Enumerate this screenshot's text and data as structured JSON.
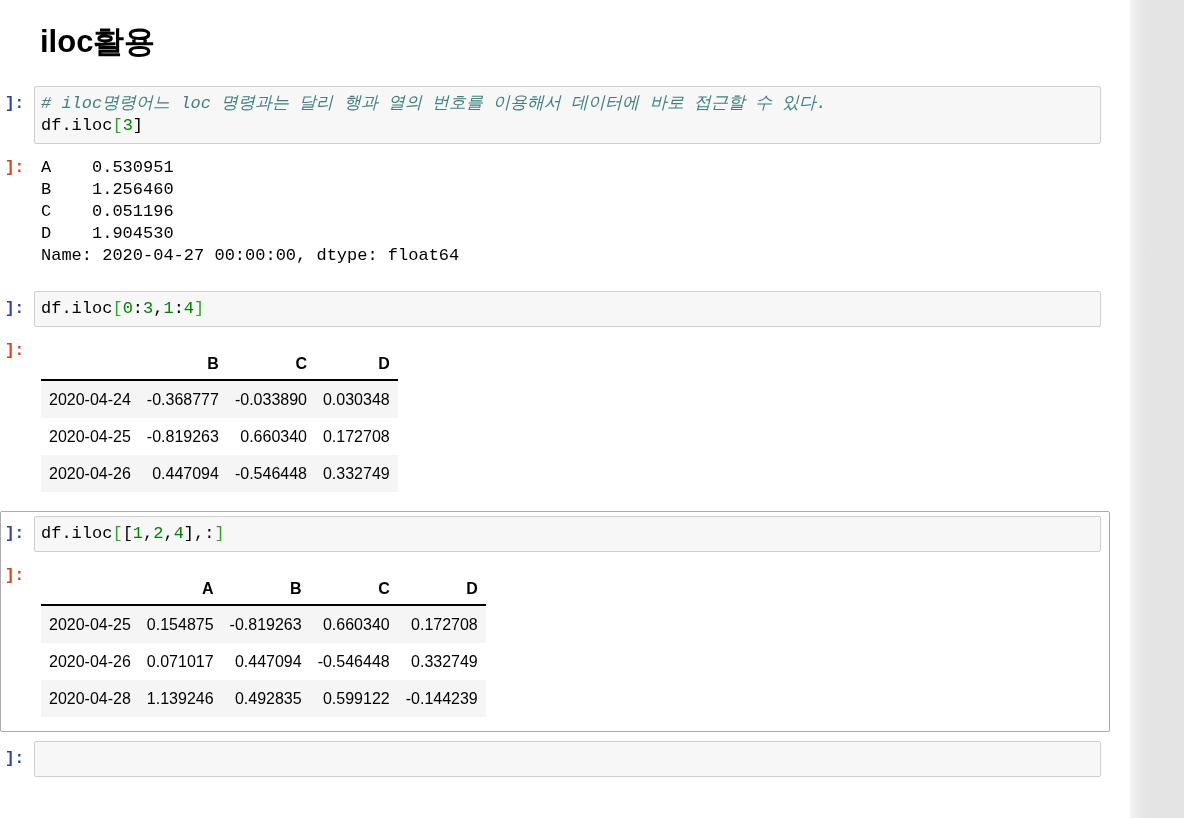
{
  "heading": "iloc활용",
  "cells": [
    {
      "prompt": "]:",
      "selected": false,
      "code_lines": [
        [
          {
            "kind": "comment",
            "text": "# iloc명령어느 loc 명령과는 달리 행과 열의 번호를 이용해서 데이터에 바로 접근할 수 있다."
          }
        ],
        [
          {
            "kind": "plain",
            "text": "df.iloc"
          },
          {
            "kind": "op",
            "text": "["
          },
          {
            "kind": "number",
            "text": "3"
          },
          {
            "kind": "plain",
            "text": "]"
          }
        ]
      ],
      "output": {
        "prompt": "]:",
        "kind": "text",
        "lines": [
          "A    0.530951",
          "B    1.256460",
          "C    0.051196",
          "D    1.904530",
          "Name: 2020-04-27 00:00:00, dtype: float64"
        ]
      }
    },
    {
      "prompt": "]:",
      "selected": false,
      "code_lines": [
        [
          {
            "kind": "plain",
            "text": "df.iloc"
          },
          {
            "kind": "op",
            "text": "["
          },
          {
            "kind": "number",
            "text": "0"
          },
          {
            "kind": "plain",
            "text": ":"
          },
          {
            "kind": "number",
            "text": "3"
          },
          {
            "kind": "plain",
            "text": ","
          },
          {
            "kind": "number",
            "text": "1"
          },
          {
            "kind": "plain",
            "text": ":"
          },
          {
            "kind": "number",
            "text": "4"
          },
          {
            "kind": "op",
            "text": "]"
          }
        ]
      ],
      "output": {
        "prompt": "]:",
        "kind": "table",
        "columns": [
          "",
          "B",
          "C",
          "D"
        ],
        "rows": [
          [
            "2020-04-24",
            "-0.368777",
            "-0.033890",
            "0.030348"
          ],
          [
            "2020-04-25",
            "-0.819263",
            "0.660340",
            "0.172708"
          ],
          [
            "2020-04-26",
            "0.447094",
            "-0.546448",
            "0.332749"
          ]
        ]
      }
    },
    {
      "prompt": "]:",
      "selected": true,
      "code_lines": [
        [
          {
            "kind": "plain",
            "text": "df.iloc"
          },
          {
            "kind": "op",
            "text": "["
          },
          {
            "kind": "plain",
            "text": "["
          },
          {
            "kind": "number",
            "text": "1"
          },
          {
            "kind": "plain",
            "text": ","
          },
          {
            "kind": "number",
            "text": "2"
          },
          {
            "kind": "plain",
            "text": ","
          },
          {
            "kind": "number",
            "text": "4"
          },
          {
            "kind": "plain",
            "text": "],:"
          },
          {
            "kind": "op",
            "text": "]"
          }
        ]
      ],
      "output": {
        "prompt": "]:",
        "kind": "table",
        "columns": [
          "",
          "A",
          "B",
          "C",
          "D"
        ],
        "rows": [
          [
            "2020-04-25",
            "0.154875",
            "-0.819263",
            "0.660340",
            "0.172708"
          ],
          [
            "2020-04-26",
            "0.071017",
            "0.447094",
            "-0.546448",
            "0.332749"
          ],
          [
            "2020-04-28",
            "1.139246",
            "0.492835",
            "0.599122",
            "-0.144239"
          ]
        ]
      }
    },
    {
      "prompt": "]:",
      "selected": false
    }
  ]
}
